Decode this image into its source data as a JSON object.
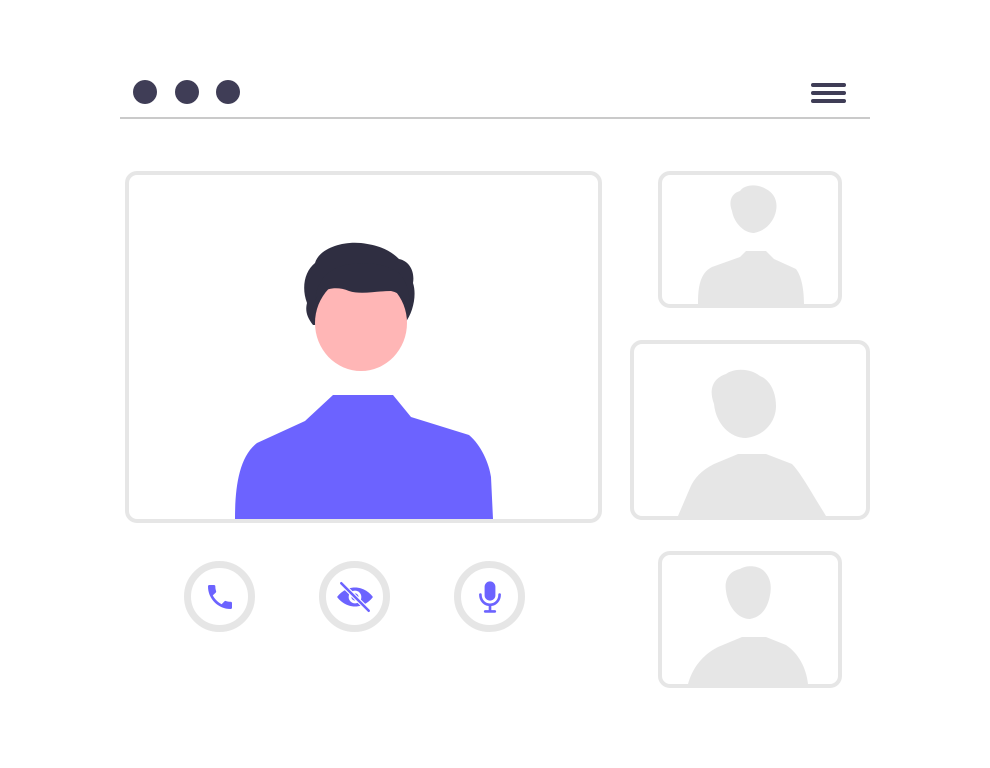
{
  "window": {
    "controls": [
      "window-dot",
      "window-dot",
      "window-dot"
    ],
    "menu_icon": "hamburger-menu-icon"
  },
  "colors": {
    "dark": "#3f3d56",
    "hair": "#2f2e41",
    "skin": "#ffb6b6",
    "accent": "#6c63ff",
    "placeholder": "#e6e6e6",
    "divider": "#cacaca",
    "background": "#ffffff"
  },
  "main_video": {
    "participant": "avatar-person",
    "placeholder_count": 3
  },
  "controls": [
    {
      "icon": "phone-icon",
      "action": "call"
    },
    {
      "icon": "eye-off-icon",
      "action": "camera-off"
    },
    {
      "icon": "microphone-icon",
      "action": "microphone"
    }
  ]
}
